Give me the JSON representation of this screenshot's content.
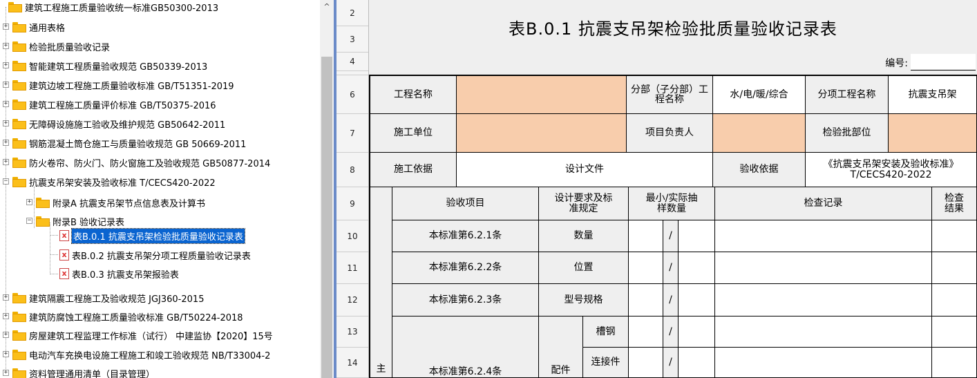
{
  "tree": {
    "root": "建筑工程施工质量验收统一标准GB50300-2013",
    "items": [
      "通用表格",
      "检验批质量验收记录",
      "智能建筑工程质量验收规范 GB50339-2013",
      "建筑边坡工程施工质量验收标准 GB/T51351-2019",
      "建筑工程施工质量评价标准 GB/T50375-2016",
      "无障碍设施施工验收及维护规范 GB50642-2011",
      "钢筋混凝土筒仓施工与质量验收规范 GB 50669-2011",
      "防火卷帘、防火门、防火窗施工及验收规范 GB50877-2014",
      "抗震支吊架安装及验收标准 T/CECS420-2022",
      "附录A 抗震支吊架节点信息表及计算书",
      "附录B 验收记录表",
      "表B.0.1 抗震支吊架检验批质量验收记录表",
      "表B.0.2 抗震支吊架分项工程质量验收记录表",
      "表B.0.3 抗震支吊架报验表",
      "建筑隔震工程施工及验收规范 JGJ360-2015",
      "建筑防腐蚀工程施工质量验收标准 GB/T50224-2018",
      "房屋建筑工程监理工作标准（试行） 中建监协【2020】15号",
      "电动汽车充换电设施工程施工和竣工验收规范 NB/T33004-2",
      "资料管理通用清单（目录管理）"
    ],
    "scroll_up_glyph": "^"
  },
  "sheet": {
    "row_numbers": [
      "2",
      "3",
      "4",
      "",
      "6",
      "7",
      "8",
      "9",
      "10",
      "11",
      "12",
      "13",
      "14"
    ],
    "title": "表B.0.1 抗震支吊架检验批质量验收记录表",
    "number_label": "编号:",
    "row6": {
      "project_name_label": "工程名称",
      "subdivision_label": "分部（子分部）工程名称",
      "subdivision_value": "水/电/暖/综合",
      "sub_item_label": "分项工程名称",
      "sub_item_value": "抗震支吊架"
    },
    "row7": {
      "contractor_label": "施工单位",
      "manager_label": "项目负责人",
      "batch_location_label": "检验批部位"
    },
    "row8": {
      "basis_label": "施工依据",
      "basis_value": "设计文件",
      "acceptance_basis_label": "验收依据",
      "acceptance_basis_value": "《抗震支吊架安装及验收标准》T/CECS420-2022"
    },
    "row9": {
      "item_header": "验收项目",
      "design_header": "设计要求及标准规定",
      "sample_header": "最小/实际抽样数量",
      "record_header": "检查记录",
      "result_header": "检查结果"
    },
    "row10": {
      "clause": "本标准第6.2.1条",
      "req": "数量",
      "slash": "/"
    },
    "row11": {
      "clause": "本标准第6.2.2条",
      "req": "位置",
      "slash": "/"
    },
    "row12": {
      "clause": "本标准第6.2.3条",
      "req": "型号规格",
      "slash": "/"
    },
    "row13": {
      "req": "槽钢",
      "slash": "/"
    },
    "row14": {
      "clause": "本标准第6.2.4条",
      "group": "配件",
      "req": "连接件",
      "slash": "/",
      "main": "主"
    }
  }
}
